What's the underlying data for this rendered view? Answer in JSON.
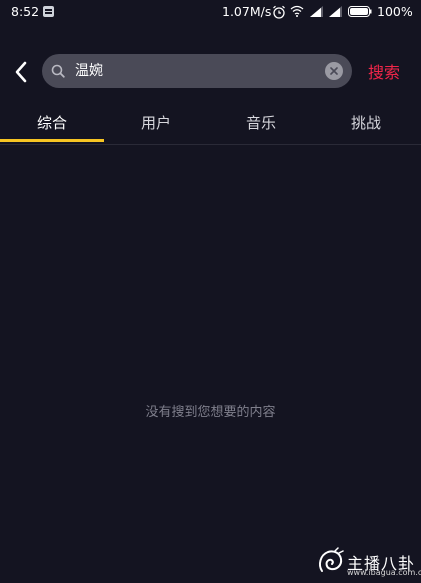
{
  "status_bar": {
    "time": "8:52",
    "network_speed": "1.07M/s",
    "battery": "100%",
    "icons": [
      "app-icon",
      "alarm-icon",
      "wifi-icon",
      "signal-icon",
      "signal-icon",
      "battery-icon"
    ]
  },
  "search": {
    "query": "温婉",
    "submit_label": "搜索",
    "accent_color": "#f2264a"
  },
  "tabs": [
    {
      "label": "综合",
      "active": true
    },
    {
      "label": "用户",
      "active": false
    },
    {
      "label": "音乐",
      "active": false
    },
    {
      "label": "挑战",
      "active": false
    }
  ],
  "tab_indicator_color": "#f7c523",
  "empty_state": {
    "message": "没有搜到您想要的内容"
  },
  "watermark": {
    "title": "主播八卦",
    "domain": "www.ibagua.com.cn"
  }
}
